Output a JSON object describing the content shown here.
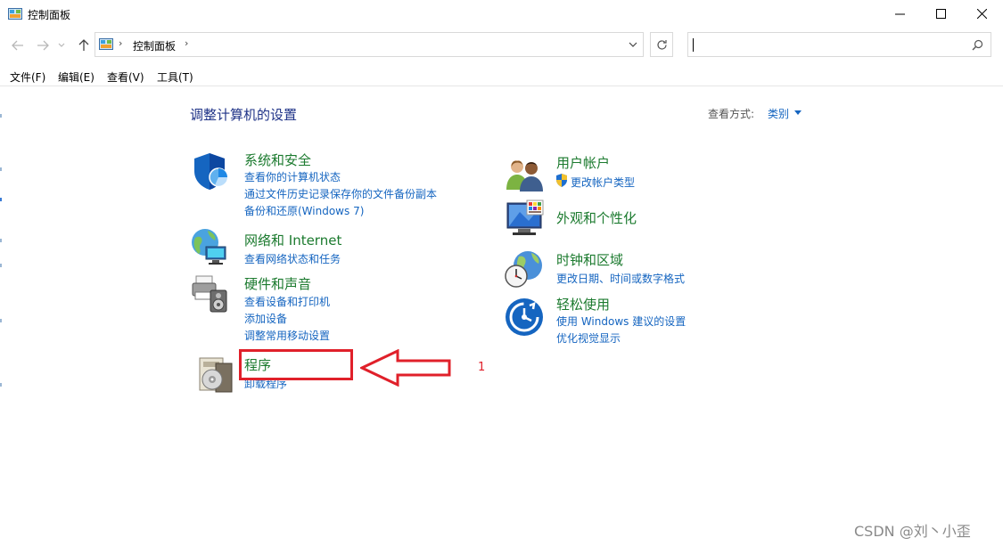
{
  "window": {
    "title": "控制面板",
    "icon": "control-panel-icon",
    "controls": [
      "minimize-icon",
      "maximize-icon",
      "close-icon"
    ]
  },
  "nav": {
    "breadcrumb_root": "控制面板",
    "search_placeholder": ""
  },
  "menubar": {
    "items": [
      "文件(F)",
      "编辑(E)",
      "查看(V)",
      "工具(T)"
    ]
  },
  "main": {
    "heading": "调整计算机的设置",
    "view_by_label": "查看方式:",
    "view_by_value": "类别"
  },
  "categories": {
    "security": {
      "title": "系统和安全",
      "icon": "shield-icon",
      "links": [
        "查看你的计算机状态",
        "通过文件历史记录保存你的文件备份副本",
        "备份和还原(Windows 7)"
      ]
    },
    "network": {
      "title": "网络和 Internet",
      "icon": "network-globe-icon",
      "links": [
        "查看网络状态和任务"
      ]
    },
    "hardware": {
      "title": "硬件和声音",
      "icon": "printer-speaker-icon",
      "links": [
        "查看设备和打印机",
        "添加设备",
        "调整常用移动设置"
      ]
    },
    "programs": {
      "title": "程序",
      "icon": "programs-disc-icon",
      "links": [
        "卸载程序"
      ]
    },
    "users": {
      "title": "用户帐户",
      "icon": "users-icon",
      "links": [
        "更改帐户类型"
      ]
    },
    "appearance": {
      "title": "外观和个性化",
      "icon": "monitor-palette-icon",
      "links": []
    },
    "clock": {
      "title": "时钟和区域",
      "icon": "clock-globe-icon",
      "links": [
        "更改日期、时间或数字格式"
      ]
    },
    "ease": {
      "title": "轻松使用",
      "icon": "accessibility-icon",
      "links": [
        "使用 Windows 建议的设置",
        "优化视觉显示"
      ]
    }
  },
  "annotation": {
    "number": "1",
    "color": "#e0202a"
  },
  "watermark": "CSDN @刘丶小歪"
}
